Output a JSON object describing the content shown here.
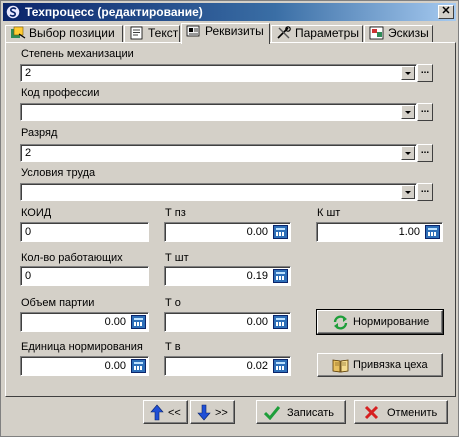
{
  "window": {
    "title": "Техпроцесс (редактирование)",
    "close_glyph": "✕"
  },
  "tabs": [
    {
      "label": "Выбор позиции",
      "icon": "position-icon"
    },
    {
      "label": "Текст",
      "icon": "text-icon"
    },
    {
      "label": "Реквизиты",
      "icon": "details-icon",
      "active": true
    },
    {
      "label": "Параметры",
      "icon": "parameters-icon"
    },
    {
      "label": "Эскизы",
      "icon": "sketches-icon"
    }
  ],
  "form": {
    "mechanization": {
      "label": "Степень механизации",
      "value": "2"
    },
    "profession": {
      "label": "Код профессии",
      "value": ""
    },
    "grade": {
      "label": "Разряд",
      "value": "2"
    },
    "conditions": {
      "label": "Условия труда",
      "value": ""
    },
    "koid": {
      "label": "КОИД",
      "value": "0"
    },
    "t_pz": {
      "label": "Т пз",
      "value": "0.00"
    },
    "k_sht": {
      "label": "К шт",
      "value": "1.00"
    },
    "workers": {
      "label": "Кол-во работающих",
      "value": "0"
    },
    "t_sht": {
      "label": "Т шт",
      "value": "0.19"
    },
    "batch": {
      "label": "Объем партии",
      "value": "0.00"
    },
    "t_o": {
      "label": "Т о",
      "value": "0.00"
    },
    "unit": {
      "label": "Единица нормирования",
      "value": "0.00"
    },
    "t_v": {
      "label": "Т в",
      "value": "0.02"
    },
    "dots_label": "..."
  },
  "actions": {
    "normalize": "Нормирование",
    "workshop": "Привязка цеха",
    "prev": "<<",
    "next": ">>",
    "save": "Записать",
    "cancel": "Отменить"
  },
  "colors": {
    "title_start": "#0a246a",
    "title_end": "#a6caf0",
    "face": "#d4d0c8"
  }
}
